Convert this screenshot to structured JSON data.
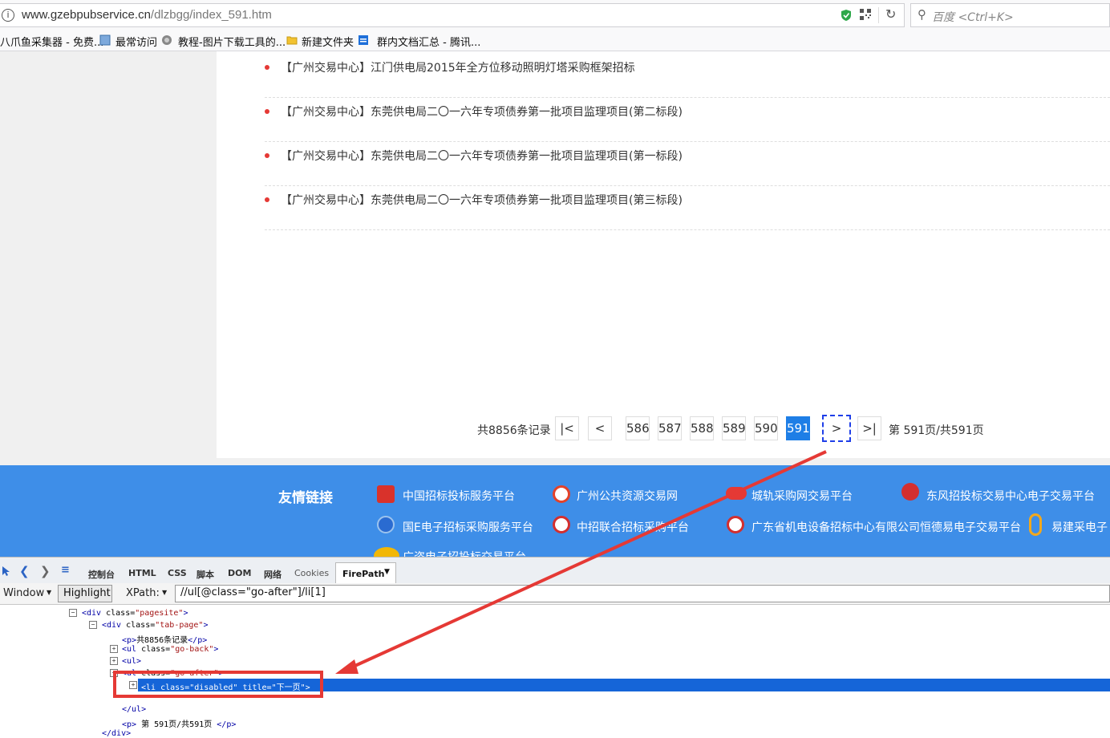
{
  "browser": {
    "url_host": "www.gzebpubservice.cn",
    "url_path": "/dlzbgg/index_591.htm",
    "search_placeholder": "百度 <Ctrl+K>",
    "bookmarks": [
      {
        "label": "八爪鱼采集器 - 免费..."
      },
      {
        "label": "最常访问"
      },
      {
        "label": "教程-图片下载工具的..."
      },
      {
        "label": "新建文件夹"
      },
      {
        "label": "群内文档汇总 - 腾讯..."
      }
    ]
  },
  "news": [
    "【广州交易中心】江门供电局2015年全方位移动照明灯塔采购框架招标",
    "【广州交易中心】东莞供电局二〇一六年专项债券第一批项目监理项目(第二标段)",
    "【广州交易中心】东莞供电局二〇一六年专项债券第一批项目监理项目(第一标段)",
    "【广州交易中心】东莞供电局二〇一六年专项债券第一批项目监理项目(第三标段)"
  ],
  "pager": {
    "total": "共8856条记录",
    "first": "|<",
    "prev": "<",
    "pages": [
      "586",
      "587",
      "588",
      "589",
      "590",
      "591"
    ],
    "current": "591",
    "next": ">",
    "last": ">|",
    "info": "第 591页/共591页"
  },
  "footer": {
    "title": "友情链接",
    "links": [
      "中国招标投标服务平台",
      "广州公共资源交易网",
      "城轨采购网交易平台",
      "东风招投标交易中心电子交易平台",
      "国E电子招标采购服务平台",
      "中招联合招标采购平台",
      "广东省机电设备招标中心有限公司恒德易电子交易平台",
      "易建采电子",
      "广咨电子招投标交易平台"
    ]
  },
  "devtools": {
    "tabs": [
      "控制台",
      "HTML",
      "CSS",
      "脚本",
      "DOM",
      "网络",
      "Cookies"
    ],
    "active_tab": "FirePath",
    "window_label": "Window",
    "highlight_label": "Highlight",
    "xpath_label": "XPath:",
    "xpath_value": "//ul[@class=\"go-after\"]/li[1]",
    "tree": {
      "l1": {
        "tag": "<div",
        "attr": " class=",
        "val": "\"pagesite\"",
        "end": ">"
      },
      "l2": {
        "tag": "<div",
        "attr": " class=",
        "val": "\"tab-page\"",
        "end": ">"
      },
      "l3": {
        "open": "<p>",
        "text": "共8856条记录",
        "close": "</p>"
      },
      "l4": {
        "tag": "<ul",
        "attr": " class=",
        "val": "\"go-back\"",
        "end": ">"
      },
      "l5": "<ul>",
      "l6": {
        "tag": "<ul",
        "attr": " class=",
        "val": "\"go-after\"",
        "end": ">"
      },
      "l7": {
        "tag": "<li",
        "attr1": " class=",
        "val1": "\"disabled\"",
        "attr2": " title=",
        "val2": "\"下一页\"",
        "end": ">"
      },
      "l8": "</ul>",
      "l9": {
        "open": "<p>",
        "text": " 第 591页/共591页 ",
        "close": "</p>"
      },
      "l10": "</div>"
    }
  },
  "colors": {
    "accent": "#1e7ee6",
    "footer_bg": "#3e8ee8",
    "annotation": "#e53935",
    "selection": "#1565d8"
  }
}
